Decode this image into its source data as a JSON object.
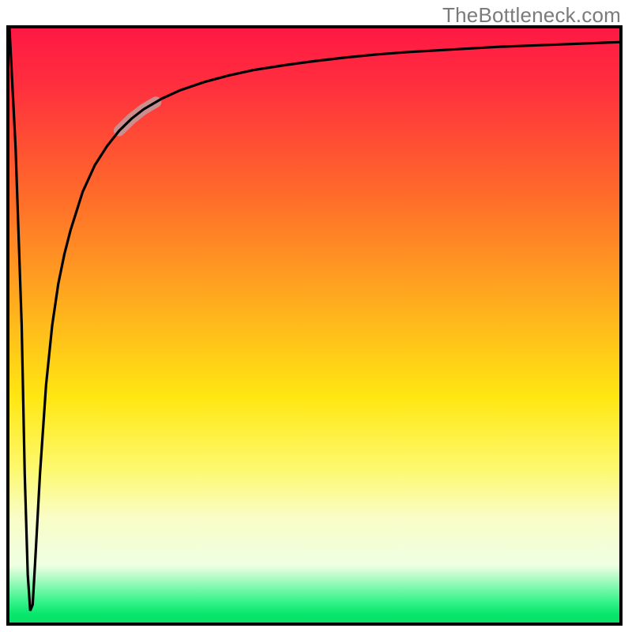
{
  "attribution": "TheBottleneck.com",
  "chart_data": {
    "type": "line",
    "title": "",
    "xlabel": "",
    "ylabel": "",
    "xlim": [
      0,
      100
    ],
    "ylim": [
      0,
      100
    ],
    "colors": {
      "curve": "#000000",
      "highlight": "#c98f8e",
      "gradient_top": "#ff1744",
      "gradient_bottom": "#09e76d"
    },
    "series": [
      {
        "name": "bottleneck-curve",
        "x": [
          0.0,
          1.0,
          2.0,
          2.5,
          3.0,
          3.4,
          3.8,
          4.2,
          5.0,
          6.0,
          7.0,
          8.0,
          9.0,
          10.0,
          12.0,
          14.0,
          16.0,
          18.0,
          20.0,
          22.0,
          25.0,
          28.0,
          32.0,
          36.0,
          40.0,
          45.0,
          50.0,
          55.0,
          60.0,
          65.0,
          70.0,
          75.0,
          80.0,
          85.0,
          90.0,
          95.0,
          100.0
        ],
        "values": [
          100.0,
          80.0,
          50.0,
          25.0,
          8.0,
          2.0,
          3.0,
          10.0,
          25.0,
          40.0,
          50.0,
          57.0,
          62.0,
          66.0,
          72.5,
          77.0,
          80.2,
          82.8,
          84.8,
          86.4,
          88.2,
          89.6,
          91.0,
          92.1,
          93.0,
          93.8,
          94.5,
          95.1,
          95.6,
          96.0,
          96.3,
          96.6,
          96.9,
          97.1,
          97.3,
          97.5,
          97.7
        ]
      }
    ],
    "highlight_segment": {
      "x_from": 18.0,
      "x_to": 24.0
    }
  }
}
